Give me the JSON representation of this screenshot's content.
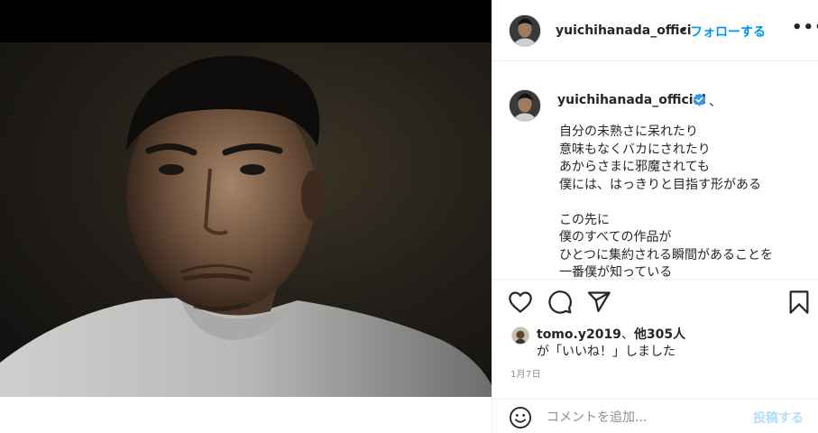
{
  "post": {
    "header": {
      "username": "yuichihanada_offici",
      "separator": "•",
      "follow_label": "フォローする",
      "more_label": "•••"
    },
    "caption": {
      "username": "yuichihanada_official",
      "after_name": "、",
      "lines": [
        "自分の未熟さに呆れたり",
        "意味もなくバカにされたり",
        "あからさまに邪魔されても",
        "僕には、はっきりと目指す形がある",
        "",
        "この先に",
        "僕のすべての作品が",
        "ひとつに集約される瞬間があることを",
        "一番僕が知っている"
      ]
    },
    "likes": {
      "user": "tomo.y2019",
      "separator": "、",
      "others": "他305人",
      "suffix": "が「いいね！」しました"
    },
    "date": "1月7日",
    "comment": {
      "placeholder": "コメントを追加...",
      "post_label": "投稿する"
    }
  },
  "icons": {
    "like": "heart-icon",
    "comment": "speech-bubble-icon",
    "share": "paper-plane-icon",
    "save": "bookmark-icon",
    "emoji": "smiley-icon",
    "verified": "verified-badge-icon"
  },
  "colors": {
    "link_blue": "#0095f6",
    "post_disabled": "#b2dffc",
    "meta_gray": "#8e8e8e",
    "text": "#262626"
  }
}
